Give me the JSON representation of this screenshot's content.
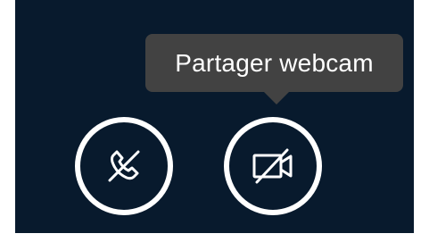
{
  "tooltip": {
    "text": "Partager webcam"
  },
  "controls": {
    "hangup": {
      "icon": "phone-hangup-icon"
    },
    "webcam": {
      "icon": "video-off-icon"
    }
  },
  "colors": {
    "background": "#081a2d",
    "tooltip_bg": "#424242",
    "button_ring": "#ffffff",
    "icon": "#ffffff",
    "tooltip_text": "#ffffff"
  }
}
